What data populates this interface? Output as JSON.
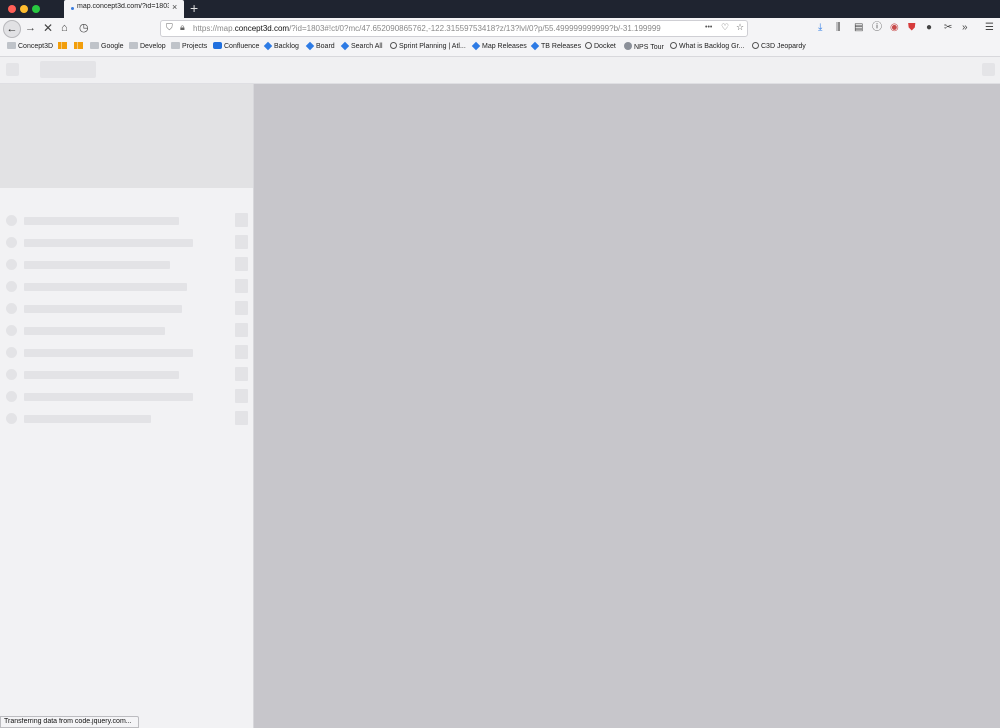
{
  "browser": {
    "tab": {
      "title": "map.concept3d.com/?id=1803",
      "close_glyph": "×"
    },
    "new_tab_glyph": "+",
    "url": {
      "prefix": "https://map.",
      "domain": "concept3d.com",
      "rest": "/?id=1803#!ct/0?mc/47.652090865762,-122.31559753418?z/13?lvl/0?p/55.499999999999?b/-31.199999",
      "more_glyph": "•••"
    },
    "bookmarks": [
      {
        "label": "Concept3D",
        "icon": "folder-icon"
      },
      {
        "label": "",
        "icon": "bar-chart-icon"
      },
      {
        "label": "",
        "icon": "analytics-icon"
      },
      {
        "label": "Google",
        "icon": "folder-icon"
      },
      {
        "label": "Develop",
        "icon": "folder-icon"
      },
      {
        "label": "Projects",
        "icon": "folder-icon"
      },
      {
        "label": "Confluence",
        "icon": "confluence-icon"
      },
      {
        "label": "Backlog",
        "icon": "jira-icon"
      },
      {
        "label": "Board",
        "icon": "jira-icon"
      },
      {
        "label": "Search All",
        "icon": "jira-icon"
      },
      {
        "label": "Sprint Planning | Atl...",
        "icon": "globe-icon"
      },
      {
        "label": "Map Releases",
        "icon": "jira-icon"
      },
      {
        "label": "TB Releases",
        "icon": "jira-icon"
      },
      {
        "label": "Docket",
        "icon": "globe-icon"
      },
      {
        "label": "NPS Tour",
        "icon": "nps-icon"
      },
      {
        "label": "What is Backlog Gr...",
        "icon": "globe-icon"
      },
      {
        "label": "C3D Jeopardy",
        "icon": "globe-icon"
      }
    ],
    "status": "Transferring data from code.jquery.com..."
  },
  "colors": {
    "titlebar": "#1f2430",
    "map_loading": "#c7c6cb",
    "skeleton": "#e3e3e6"
  }
}
